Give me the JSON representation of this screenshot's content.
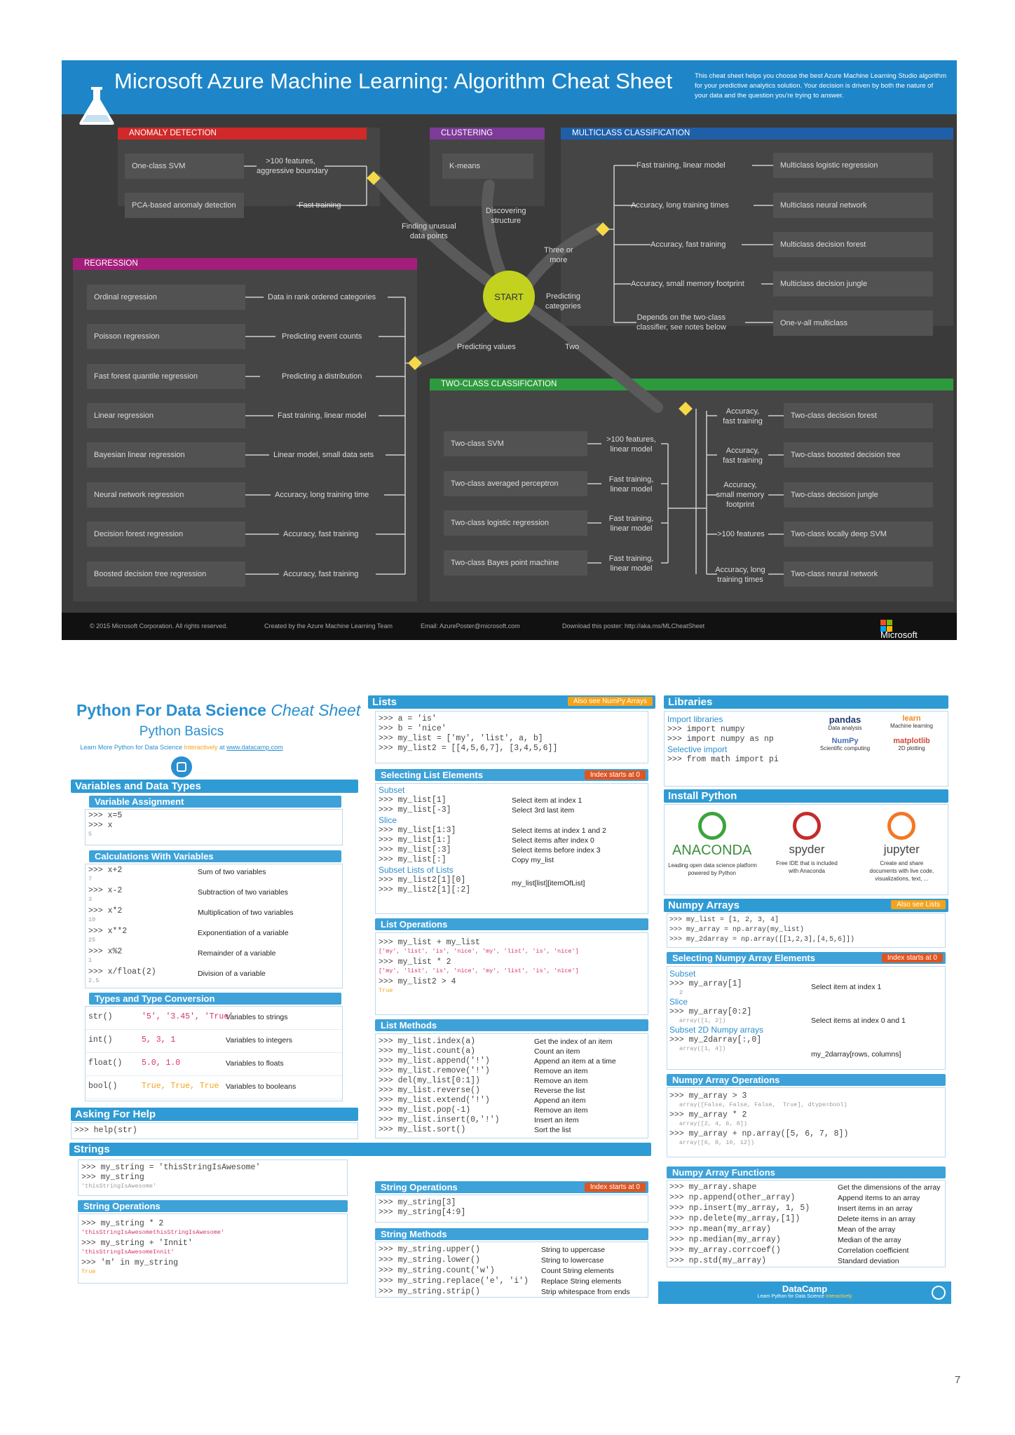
{
  "azure": {
    "title": "Microsoft Azure Machine Learning: Algorithm Cheat Sheet",
    "description": "This cheat sheet helps you choose the best Azure Machine Learning Studio algorithm for your predictive analytics solution. Your decision is driven by both the nature of your data and the question you're trying to answer.",
    "start": "START",
    "colors": {
      "header": "#1e86c8",
      "anomaly": "#d12929",
      "clustering": "#7d3a98",
      "multiclass": "#1f5fa8",
      "regression": "#a31e7a",
      "twoclass": "#2d9a3e",
      "start": "#c2d21f",
      "diamond": "#f5d949"
    },
    "anomaly": {
      "header": "ANOMALY DETECTION",
      "items": [
        {
          "algo": "One-class SVM",
          "cond": ">100 features,\naggressive boundary"
        },
        {
          "algo": "PCA-based anomaly detection",
          "cond": "Fast training"
        }
      ]
    },
    "clustering": {
      "header": "CLUSTERING",
      "items": [
        {
          "algo": "K-means"
        }
      ]
    },
    "multiclass": {
      "header": "MULTICLASS CLASSIFICATION",
      "items": [
        {
          "cond": "Fast training, linear model",
          "algo": "Multiclass logistic regression"
        },
        {
          "cond": "Accuracy, long training times",
          "algo": "Multiclass neural network"
        },
        {
          "cond": "Accuracy, fast training",
          "algo": "Multiclass decision forest"
        },
        {
          "cond": "Accuracy, small memory footprint",
          "algo": "Multiclass decision jungle"
        },
        {
          "cond": "Depends on the two-class\nclassifier, see notes below",
          "algo": "One-v-all multiclass"
        }
      ]
    },
    "regression": {
      "header": "REGRESSION",
      "items": [
        {
          "algo": "Ordinal regression",
          "cond": "Data in rank ordered categories"
        },
        {
          "algo": "Poisson regression",
          "cond": "Predicting event counts"
        },
        {
          "algo": "Fast forest quantile regression",
          "cond": "Predicting a distribution"
        },
        {
          "algo": "Linear regression",
          "cond": "Fast training, linear model"
        },
        {
          "algo": "Bayesian linear regression",
          "cond": "Linear model, small data sets"
        },
        {
          "algo": "Neural network regression",
          "cond": "Accuracy, long training time"
        },
        {
          "algo": "Decision forest regression",
          "cond": "Accuracy, fast training"
        },
        {
          "algo": "Boosted decision tree regression",
          "cond": "Accuracy, fast training"
        }
      ]
    },
    "twoclass": {
      "header": "TWO-CLASS CLASSIFICATION",
      "left": [
        {
          "algo": "Two-class SVM",
          "cond": ">100 features,\nlinear model"
        },
        {
          "algo": "Two-class averaged perceptron",
          "cond": "Fast training,\nlinear model"
        },
        {
          "algo": "Two-class logistic regression",
          "cond": "Fast training,\nlinear model"
        },
        {
          "algo": "Two-class Bayes point machine",
          "cond": "Fast training,\nlinear model"
        }
      ],
      "right": [
        {
          "cond": "Accuracy,\nfast training",
          "algo": "Two-class decision forest"
        },
        {
          "cond": "Accuracy,\nfast training",
          "algo": "Two-class boosted decision tree"
        },
        {
          "cond": "Accuracy,\nsmall memory\nfootprint",
          "algo": "Two-class decision jungle"
        },
        {
          "cond": ">100 features",
          "algo": "Two-class locally deep SVM"
        },
        {
          "cond": "Accuracy, long\ntraining times",
          "algo": "Two-class neural network"
        }
      ]
    },
    "paths": {
      "discovering": "Discovering\nstructure",
      "finding": "Finding unusual\ndata points",
      "three": "Three or\nmore",
      "predicting_categories": "Predicting\ncategories",
      "predicting_values": "Predicting values",
      "two": "Two"
    },
    "footer": {
      "copyright": "© 2015 Microsoft Corporation. All rights reserved.",
      "created": "Created by the Azure Machine Learning Team",
      "email": "Email: AzurePoster@microsoft.com",
      "download": "Download this poster: http://aka.ms/MLCheatSheet",
      "brand": "Microsoft"
    }
  },
  "python": {
    "title_main": "Python For Data Science",
    "title_italic": "Cheat Sheet",
    "subtitle": "Python Basics",
    "learn_pre": "Learn More Python for Data Science",
    "learn_mid": "Interactively",
    "learn_at": "at",
    "learn_link": "www.datacamp.com",
    "variables": {
      "header": "Variables and Data Types",
      "assign_header": "Variable Assignment",
      "assign_code": [
        ">>> x=5",
        ">>> x",
        "5"
      ],
      "calc_header": "Calculations With Variables",
      "calc": [
        {
          "code": ">>> x+2",
          "out": "7",
          "desc": "Sum of two variables"
        },
        {
          "code": ">>> x-2",
          "out": "3",
          "desc": "Subtraction of two variables"
        },
        {
          "code": ">>> x*2",
          "out": "10",
          "desc": "Multiplication of two variables"
        },
        {
          "code": ">>> x**2",
          "out": "25",
          "desc": "Exponentiation of a variable"
        },
        {
          "code": ">>> x%2",
          "out": "1",
          "desc": "Remainder of a variable"
        },
        {
          "code": ">>> x/float(2)",
          "out": "2.5",
          "desc": "Division of a variable"
        }
      ],
      "types_header": "Types and Type Conversion",
      "types": [
        {
          "fn": "str()",
          "vals": "'5', '3.45', 'True'",
          "desc": "Variables to strings"
        },
        {
          "fn": "int()",
          "vals": "5, 3, 1",
          "desc": "Variables to integers"
        },
        {
          "fn": "float()",
          "vals": "5.0, 1.0",
          "desc": "Variables to floats"
        },
        {
          "fn": "bool()",
          "vals": "True, True, True",
          "desc": "Variables to booleans"
        }
      ]
    },
    "help": {
      "header": "Asking For Help",
      "code": ">>> help(str)"
    },
    "lists": {
      "header": "Lists",
      "tag": "Also see NumPy Arrays",
      "code": [
        ">>> a = 'is'",
        ">>> b = 'nice'",
        ">>> my_list = ['my', 'list', a, b]",
        ">>> my_list2 = [[4,5,6,7], [3,4,5,6]]"
      ],
      "select_header": "Selecting List Elements",
      "select_tag": "Index starts at 0",
      "subset_label": "Subset",
      "subset": [
        {
          "code": ">>> my_list[1]",
          "desc": "Select item at index 1"
        },
        {
          "code": ">>> my_list[-3]",
          "desc": "Select 3rd last item"
        }
      ],
      "slice_label": "Slice",
      "slice": [
        {
          "code": ">>> my_list[1:3]",
          "desc": "Select items at index 1 and 2"
        },
        {
          "code": ">>> my_list[1:]",
          "desc": "Select items after index 0"
        },
        {
          "code": ">>> my_list[:3]",
          "desc": "Select items before index 3"
        },
        {
          "code": ">>> my_list[:]",
          "desc": "Copy my_list"
        }
      ],
      "sublists_label": "Subset Lists of Lists",
      "sublists": [
        ">>> my_list2[1][0]",
        ">>> my_list2[1][:2]"
      ],
      "sublists_desc": "my_list[list][itemOfList]",
      "ops_header": "List Operations",
      "ops": [
        {
          "code": ">>> my_list + my_list",
          "out": "['my', 'list', 'is', 'nice', 'my', 'list', 'is', 'nice']"
        },
        {
          "code": ">>> my_list * 2",
          "out": "['my', 'list', 'is', 'nice', 'my', 'list', 'is', 'nice']"
        },
        {
          "code": ">>> my_list2 > 4",
          "out": "True"
        }
      ],
      "methods_header": "List Methods",
      "methods": [
        {
          "code": ">>> my_list.index(a)",
          "desc": "Get the index of an item"
        },
        {
          "code": ">>> my_list.count(a)",
          "desc": "Count an item"
        },
        {
          "code": ">>> my_list.append('!')",
          "desc": "Append an item at a time"
        },
        {
          "code": ">>> my_list.remove('!')",
          "desc": "Remove an item"
        },
        {
          "code": ">>> del(my_list[0:1])",
          "desc": "Remove an item"
        },
        {
          "code": ">>> my_list.reverse()",
          "desc": "Reverse the list"
        },
        {
          "code": ">>> my_list.extend('!')",
          "desc": "Append an item"
        },
        {
          "code": ">>> my_list.pop(-1)",
          "desc": "Remove an item"
        },
        {
          "code": ">>> my_list.insert(0,'!')",
          "desc": "Insert an item"
        },
        {
          "code": ">>> my_list.sort()",
          "desc": "Sort the list"
        }
      ]
    },
    "strings": {
      "header": "Strings",
      "code": [
        ">>> my_string = 'thisStringIsAwesome'",
        ">>> my_string"
      ],
      "out": "'thisStringIsAwesome'",
      "ops_header": "String Operations",
      "ops": [
        {
          "code": ">>> my_string * 2",
          "out": "'thisStringIsAwesomethisStringIsAwesome'"
        },
        {
          "code": ">>> my_string + 'Innit'",
          "out": "'thisStringIsAwesomeInnit'"
        },
        {
          "code": ">>> 'm' in my_string",
          "out": "True"
        }
      ],
      "ops2_header": "String Operations",
      "ops2_tag": "Index starts at 0",
      "ops2": [
        ">>> my_string[3]",
        ">>> my_string[4:9]"
      ],
      "methods_header": "String Methods",
      "methods": [
        {
          "code": ">>> my_string.upper()",
          "desc": "String to uppercase"
        },
        {
          "code": ">>> my_string.lower()",
          "desc": "String to lowercase"
        },
        {
          "code": ">>> my_string.count('w')",
          "desc": "Count String elements"
        },
        {
          "code": ">>> my_string.replace('e', 'i')",
          "desc": "Replace String elements"
        },
        {
          "code": ">>> my_string.strip()",
          "desc": "Strip whitespace from ends"
        }
      ]
    },
    "libraries": {
      "header": "Libraries",
      "import_label": "Import libraries",
      "code1": [
        ">>> import numpy",
        ">>> import numpy as np"
      ],
      "selective_label": "Selective import",
      "code2": ">>> from math import pi",
      "libs": [
        {
          "name": "pandas",
          "desc": "Data analysis"
        },
        {
          "name": "learn",
          "desc": "Machine learning"
        },
        {
          "name": "NumPy",
          "desc": "Scientific computing"
        },
        {
          "name": "matplotlib",
          "desc": "2D plotting"
        }
      ]
    },
    "install": {
      "header": "Install Python",
      "items": [
        {
          "name": "ANACONDA",
          "desc": "Leading open data science platform\npowered by Python"
        },
        {
          "name": "spyder",
          "desc": "Free IDE that is included\nwith Anaconda"
        },
        {
          "name": "jupyter",
          "desc": "Create and share\ndocuments with live code,\nvisualizations, text, ..."
        }
      ]
    },
    "numpy": {
      "header": "Numpy Arrays",
      "tag": "Also see Lists",
      "code": [
        ">>> my_list = [1, 2, 3, 4]",
        ">>> my_array = np.array(my_list)",
        ">>> my_2darray = np.array([[1,2,3],[4,5,6]])"
      ],
      "select_header": "Selecting Numpy Array Elements",
      "select_tag": "Index starts at 0",
      "subset_label": "Subset",
      "subset_code": ">>> my_array[1]",
      "subset_out": "2",
      "subset_desc": "Select item at index 1",
      "slice_label": "Slice",
      "slice_code": ">>> my_array[0:2]",
      "slice_out": "array([1, 2])",
      "slice_desc": "Select items at index 0 and 1",
      "sub2d_label": "Subset 2D Numpy arrays",
      "sub2d_code": ">>> my_2darray[:,0]",
      "sub2d_out": "array([1, 4])",
      "sub2d_desc": "my_2darray[rows, columns]",
      "ops_header": "Numpy Array Operations",
      "ops": [
        {
          "code": ">>> my_array > 3",
          "out": "array([False, False, False,  True], dtype=bool)"
        },
        {
          "code": ">>> my_array * 2",
          "out": "array([2, 4, 6, 8])"
        },
        {
          "code": ">>> my_array + np.array([5, 6, 7, 8])",
          "out": "array([6, 8, 10, 12])"
        }
      ],
      "funcs_header": "Numpy Array Functions",
      "funcs": [
        {
          "code": ">>> my_array.shape",
          "desc": "Get the dimensions of the array"
        },
        {
          "code": ">>> np.append(other_array)",
          "desc": "Append items to an array"
        },
        {
          "code": ">>> np.insert(my_array, 1, 5)",
          "desc": "Insert items in an array"
        },
        {
          "code": ">>> np.delete(my_array,[1])",
          "desc": "Delete items in an array"
        },
        {
          "code": ">>> np.mean(my_array)",
          "desc": "Mean of the array"
        },
        {
          "code": ">>> np.median(my_array)",
          "desc": "Median of the array"
        },
        {
          "code": ">>> my_array.corrcoef()",
          "desc": "Correlation coefficient"
        },
        {
          "code": ">>> np.std(my_array)",
          "desc": "Standard deviation"
        }
      ]
    },
    "footer": {
      "brand": "DataCamp",
      "tagline": "Learn Python for Data Science",
      "tagline_hl": "Interactively"
    }
  },
  "page_number": "7"
}
